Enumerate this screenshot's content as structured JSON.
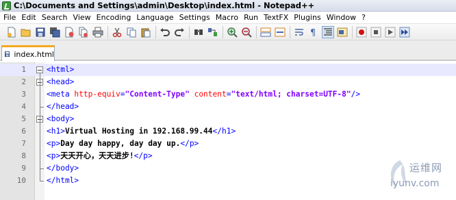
{
  "window": {
    "title": "C:\\Documents and Settings\\admin\\Desktop\\index.html - Notepad++"
  },
  "menu": [
    "File",
    "Edit",
    "Search",
    "View",
    "Encoding",
    "Language",
    "Settings",
    "Macro",
    "Run",
    "TextFX",
    "Plugins",
    "Window",
    "?"
  ],
  "toolbar": {
    "icons": [
      "new-file-icon",
      "open-file-icon",
      "save-icon",
      "save-all-icon",
      "close-icon",
      "close-all-icon",
      "print-icon",
      "cut-icon",
      "copy-icon",
      "paste-icon",
      "undo-icon",
      "redo-icon",
      "find-icon",
      "replace-icon",
      "zoom-in-icon",
      "zoom-out-icon",
      "sync-vertical-icon",
      "sync-horizontal-icon",
      "word-wrap-icon",
      "show-all-characters-icon",
      "indent-guide-icon",
      "user-defined-dialog-icon",
      "record-macro-icon",
      "stop-recording-icon",
      "play-macro-icon",
      "run-macro-multiple-icon"
    ],
    "active_icon": "indent-guide-icon"
  },
  "tabs": [
    {
      "label": "index.html",
      "active": true
    }
  ],
  "editor": {
    "current_line": 1,
    "lines": [
      {
        "n": "1",
        "tokens": [
          [
            "tag",
            "<html>"
          ]
        ]
      },
      {
        "n": "2",
        "tokens": [
          [
            "tag",
            "<head>"
          ]
        ]
      },
      {
        "n": "3",
        "tokens": [
          [
            "tag",
            "<meta "
          ],
          [
            "attr",
            "http-equiv"
          ],
          [
            "tag",
            "="
          ],
          [
            "str",
            "\"Content-Type\""
          ],
          [
            "tag",
            " "
          ],
          [
            "attr",
            "content"
          ],
          [
            "tag",
            "="
          ],
          [
            "str",
            "\"text/html; charset=UTF-8\""
          ],
          [
            "tag",
            "/>"
          ]
        ]
      },
      {
        "n": "4",
        "tokens": [
          [
            "tag",
            "</head>"
          ]
        ]
      },
      {
        "n": "5",
        "tokens": [
          [
            "tag",
            "<body>"
          ]
        ]
      },
      {
        "n": "6",
        "tokens": [
          [
            "tag",
            "<h1>"
          ],
          [
            "txt",
            "Virtual Hosting in 192.168.99.44"
          ],
          [
            "tag",
            "</h1>"
          ]
        ]
      },
      {
        "n": "7",
        "tokens": [
          [
            "tag",
            "<p>"
          ],
          [
            "txt",
            "Day day happy, day day up."
          ],
          [
            "tag",
            "</p>"
          ]
        ]
      },
      {
        "n": "8",
        "tokens": [
          [
            "tag",
            "<p>"
          ],
          [
            "txt",
            "天天开心，天天进步!"
          ],
          [
            "tag",
            "</p>"
          ]
        ]
      },
      {
        "n": "9",
        "tokens": [
          [
            "tag",
            "</body>"
          ]
        ]
      },
      {
        "n": "10",
        "tokens": [
          [
            "tag",
            "</html>"
          ]
        ]
      }
    ]
  },
  "colors": {
    "tag": "#0000ff",
    "attribute": "#ff0000",
    "string": "#8000ff",
    "text": "#000000",
    "current_line_bg": "#e8e8ff",
    "active_tab_accent": "#f4a81c"
  },
  "watermark": {
    "cn": "运维网",
    "url": "iyunv.com"
  }
}
